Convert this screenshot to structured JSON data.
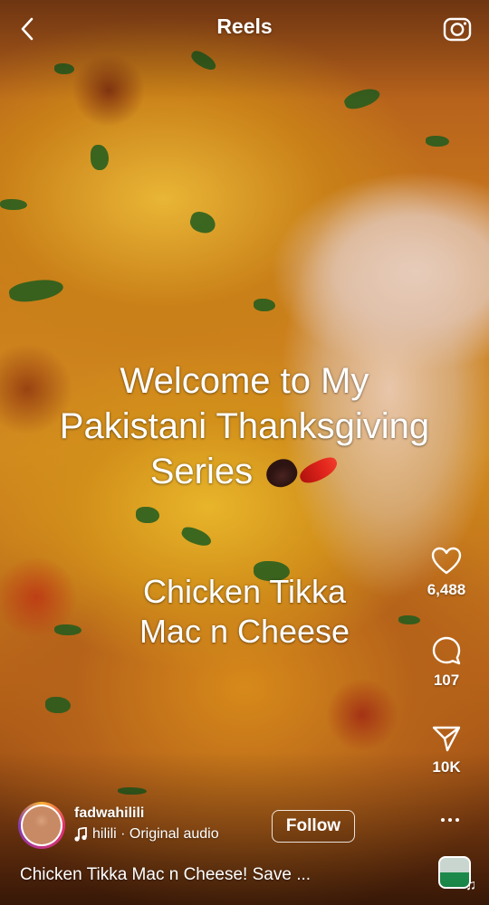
{
  "header": {
    "title": "Reels"
  },
  "overlay": {
    "headline_lines": [
      "Welcome to My",
      "Pakistani Thanksgiving",
      "Series"
    ],
    "subline_lines": [
      "Chicken Tikka",
      "Mac n Cheese"
    ]
  },
  "actions": {
    "likes": "6,488",
    "comments": "107",
    "shares": "10K"
  },
  "post": {
    "username": "fadwahilili",
    "audio": "hilili · Original audio",
    "follow_label": "Follow",
    "caption": "Chicken Tikka Mac n Cheese! Save ..."
  },
  "colors": {
    "text": "#ffffff",
    "story_ring": [
      "#f9b233",
      "#e1306c",
      "#833ab4"
    ]
  },
  "icons": [
    "back-chevron-icon",
    "camera-icon",
    "heart-icon",
    "comment-icon",
    "send-icon",
    "more-icon",
    "music-note-icon"
  ]
}
